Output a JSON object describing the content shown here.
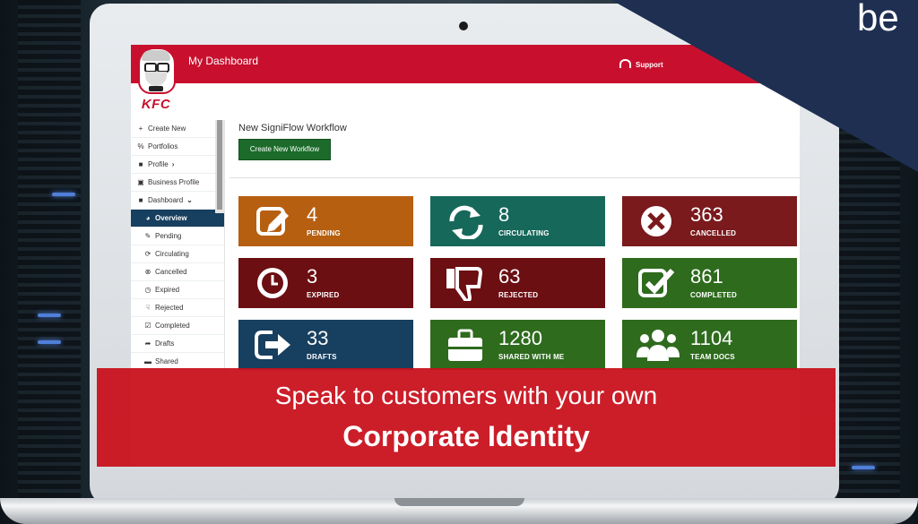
{
  "app": {
    "header_title": "My Dashboard",
    "support_label": "Support",
    "logo_text": "KFC"
  },
  "sidebar": {
    "items": [
      {
        "icon": "plus-icon",
        "glyph": "+",
        "label": "Create New",
        "sub": false,
        "active": false
      },
      {
        "icon": "link-icon",
        "glyph": "%",
        "label": "Portfolios",
        "sub": false,
        "active": false
      },
      {
        "icon": "profile-icon",
        "glyph": "■",
        "label": "Profile",
        "chevron": "›",
        "sub": false,
        "active": false
      },
      {
        "icon": "building-icon",
        "glyph": "▣",
        "label": "Business Profile",
        "sub": false,
        "active": false
      },
      {
        "icon": "dashboard-icon",
        "glyph": "■",
        "label": "Dashboard",
        "chevron": "⌄",
        "sub": false,
        "active": false
      },
      {
        "icon": "overview-icon",
        "glyph": "◕",
        "label": "Overview",
        "sub": true,
        "active": true
      },
      {
        "icon": "pending-icon",
        "glyph": "✎",
        "label": "Pending",
        "sub": true,
        "active": false
      },
      {
        "icon": "circulating-icon",
        "glyph": "⟳",
        "label": "Circulating",
        "sub": true,
        "active": false
      },
      {
        "icon": "cancelled-icon",
        "glyph": "⊗",
        "label": "Cancelled",
        "sub": true,
        "active": false
      },
      {
        "icon": "expired-icon",
        "glyph": "◷",
        "label": "Expired",
        "sub": true,
        "active": false
      },
      {
        "icon": "rejected-icon",
        "glyph": "☟",
        "label": "Rejected",
        "sub": true,
        "active": false
      },
      {
        "icon": "completed-icon",
        "glyph": "☑",
        "label": "Completed",
        "sub": true,
        "active": false
      },
      {
        "icon": "drafts-icon",
        "glyph": "➦",
        "label": "Drafts",
        "sub": true,
        "active": false
      },
      {
        "icon": "shared-icon",
        "glyph": "▬",
        "label": "Shared",
        "sub": true,
        "active": false
      }
    ]
  },
  "main": {
    "heading": "New SigniFlow Workflow",
    "create_button": "Create New Workflow"
  },
  "tiles": [
    {
      "count": "4",
      "label": "PENDING",
      "color": "#b75f10",
      "icon": "edit-icon"
    },
    {
      "count": "8",
      "label": "CIRCULATING",
      "color": "#16685a",
      "icon": "refresh-icon"
    },
    {
      "count": "363",
      "label": "CANCELLED",
      "color": "#7a1a1d",
      "icon": "cancel-circle-icon"
    },
    {
      "count": "3",
      "label": "EXPIRED",
      "color": "#6b0f13",
      "icon": "clock-icon"
    },
    {
      "count": "63",
      "label": "REJECTED",
      "color": "#6b0f13",
      "icon": "thumbs-down-icon"
    },
    {
      "count": "861",
      "label": "COMPLETED",
      "color": "#2e6b1d",
      "icon": "check-square-icon"
    },
    {
      "count": "33",
      "label": "DRAFTS",
      "color": "#173f5f",
      "icon": "sign-out-icon"
    },
    {
      "count": "1280",
      "label": "SHARED WITH ME",
      "color": "#2e6b1d",
      "icon": "briefcase-icon"
    },
    {
      "count": "1104",
      "label": "TEAM DOCS",
      "color": "#2e6b1d",
      "icon": "users-icon"
    }
  ],
  "banner": {
    "line1": "Speak to customers with your own",
    "line2": "Corporate Identity"
  },
  "corner_text": "be"
}
